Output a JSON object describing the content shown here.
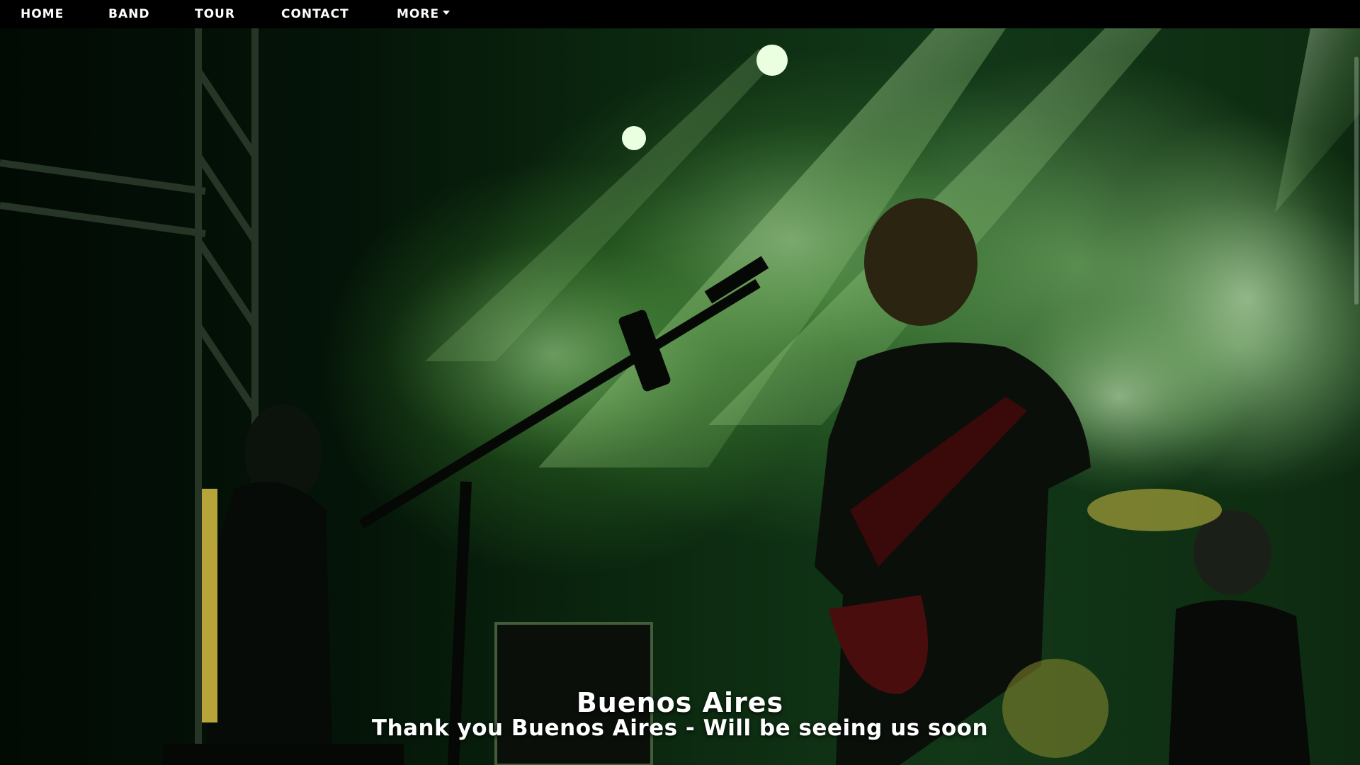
{
  "nav": {
    "items": [
      {
        "label": "Home"
      },
      {
        "label": "Band"
      },
      {
        "label": "Tour"
      },
      {
        "label": "Contact"
      },
      {
        "label": "More"
      }
    ],
    "more_icon": "chevron-down-icon"
  },
  "hero": {
    "image_description_icon": "concert-photo",
    "title": "Buenos Aires",
    "subtitle": "Thank you Buenos Aires - Will be seeing us soon"
  },
  "colors": {
    "nav_background": "#000000",
    "text": "#ffffff",
    "stage_light": "#7fcf5a"
  }
}
